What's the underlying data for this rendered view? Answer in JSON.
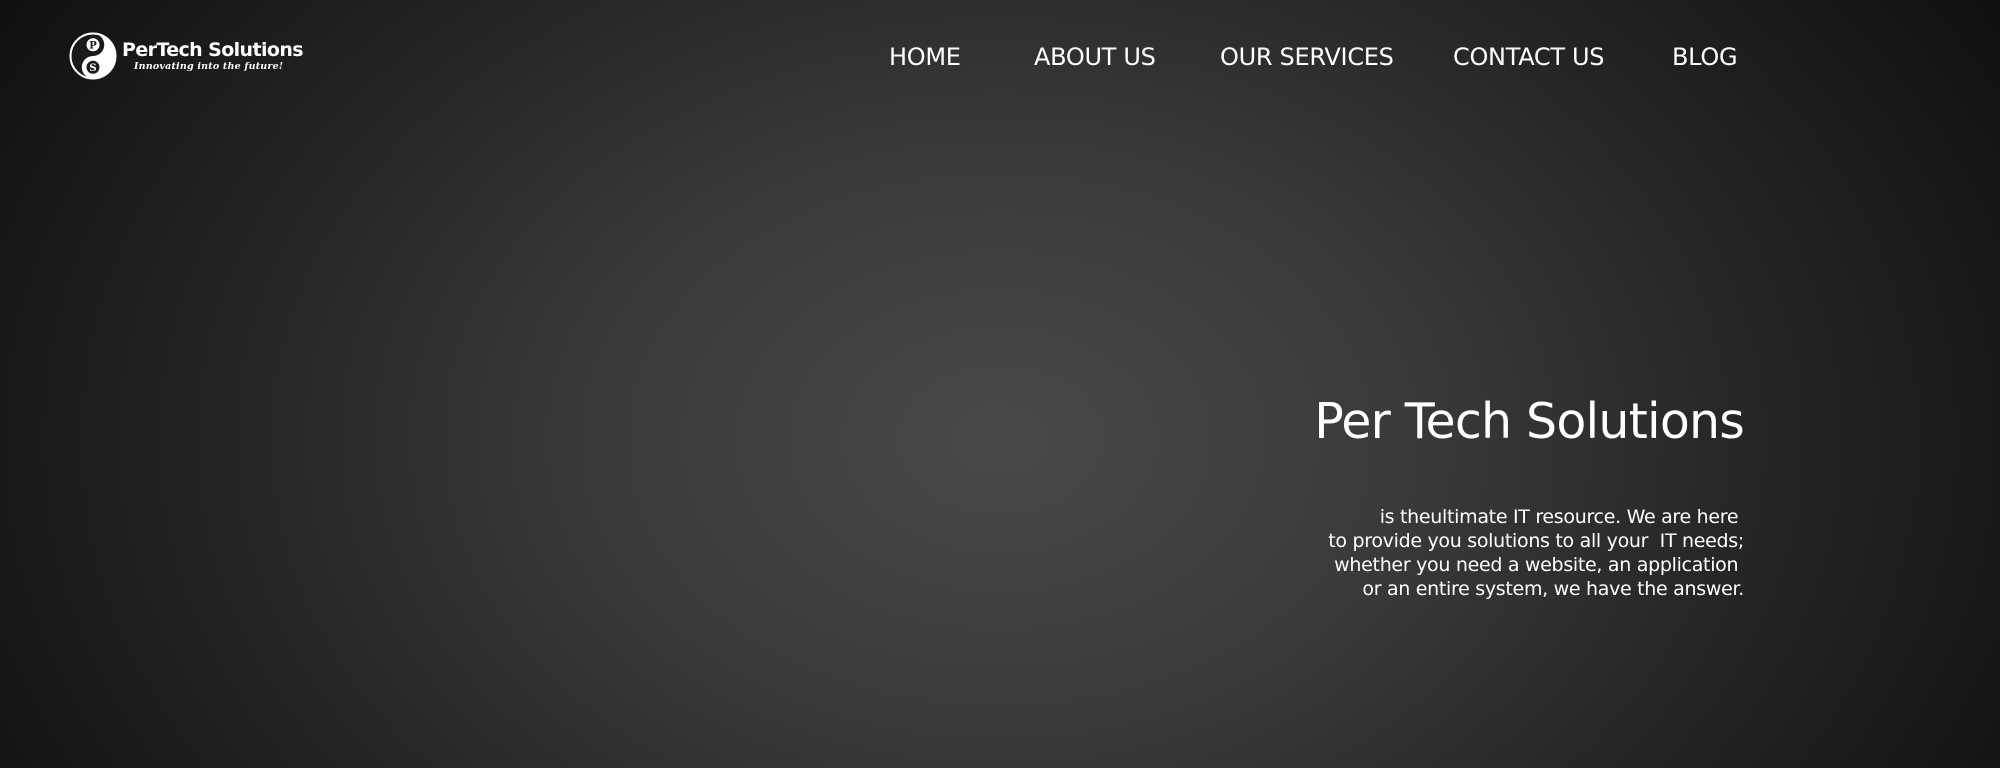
{
  "brand": {
    "name": "PerTech Solutions",
    "tagline": "Innovating into the future!",
    "emblem_letters": [
      "P",
      "S"
    ]
  },
  "nav": {
    "items": [
      {
        "label": "HOME"
      },
      {
        "label": "ABOUT US"
      },
      {
        "label": "OUR SERVICES"
      },
      {
        "label": "CONTACT US"
      },
      {
        "label": "BLOG"
      }
    ]
  },
  "hero": {
    "title": "Per Tech Solutions",
    "description_lines": [
      "is theultimate IT resource. We are here ",
      "to provide you solutions to all your  IT needs;",
      "whether you need a website, an application ",
      "or an entire system, we have the answer."
    ]
  },
  "colors": {
    "background_center": "#4a4949",
    "background_edge": "#111111",
    "text": "#ffffff"
  }
}
